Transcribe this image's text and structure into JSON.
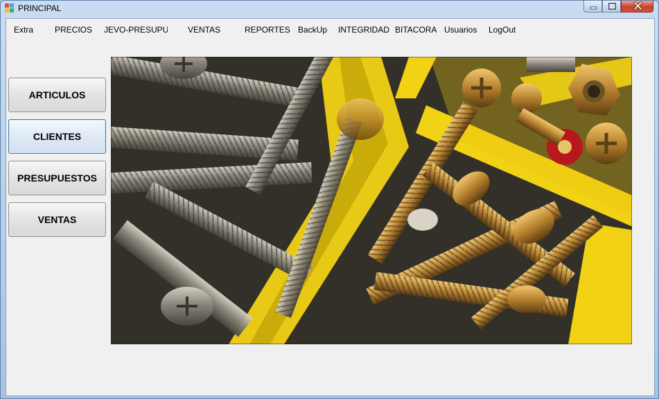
{
  "window": {
    "title": "PRINCIPAL"
  },
  "menu": [
    {
      "label": "Extra"
    },
    {
      "label": "PRECIOS"
    },
    {
      "label": "JEVO-PRESUPUEST"
    },
    {
      "label": "VENTAS"
    },
    {
      "label": "REPORTES"
    },
    {
      "label": "BackUp"
    },
    {
      "label": "INTEGRIDAD"
    },
    {
      "label": "BITACORA"
    },
    {
      "label": "Usuarios"
    },
    {
      "label": "LogOut"
    }
  ],
  "side_buttons": [
    {
      "label": "ARTICULOS"
    },
    {
      "label": "CLIENTES",
      "focused": true
    },
    {
      "label": "PRESUPUESTOS"
    },
    {
      "label": "VENTAS"
    }
  ],
  "picture": {
    "icon": "screws-photo",
    "colors": {
      "tray": "#f2d214",
      "brass": "#c9953e",
      "steel": "#9a968a",
      "shadow": "#2b2a26"
    }
  }
}
